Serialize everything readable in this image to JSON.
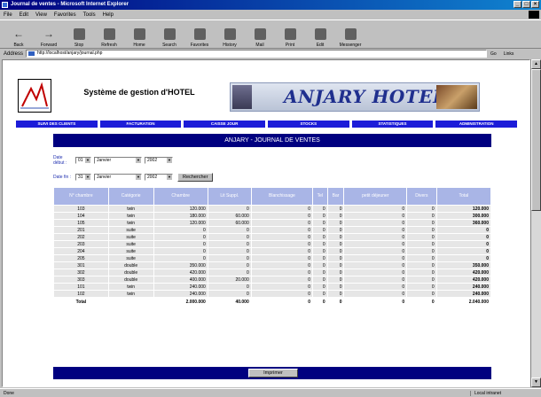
{
  "window": {
    "title": "Journal de ventes - Microsoft Internet Explorer",
    "controls": [
      "_",
      "□",
      "×"
    ]
  },
  "menu": [
    "File",
    "Edit",
    "View",
    "Favorites",
    "Tools",
    "Help"
  ],
  "toolbar": [
    {
      "label": "Back",
      "icon": "back-arrow-icon"
    },
    {
      "label": "Forward",
      "icon": "forward-arrow-icon"
    },
    {
      "label": "Stop",
      "icon": "stop-icon"
    },
    {
      "label": "Refresh",
      "icon": "refresh-icon"
    },
    {
      "label": "Home",
      "icon": "home-icon"
    },
    {
      "label": "Search",
      "icon": "search-icon"
    },
    {
      "label": "Favorites",
      "icon": "favorites-icon"
    },
    {
      "label": "History",
      "icon": "history-icon"
    },
    {
      "label": "Mail",
      "icon": "mail-icon"
    },
    {
      "label": "Print",
      "icon": "print-icon"
    },
    {
      "label": "Edit",
      "icon": "edit-icon"
    },
    {
      "label": "Messenger",
      "icon": "messenger-icon"
    }
  ],
  "address": {
    "label": "Address",
    "url": "http://localhost/anjary/journal.php",
    "go": "Go",
    "links": "Links"
  },
  "site": {
    "title": "Système de gestion d'HOTEL",
    "brand": "ANJARY HOTEL",
    "nav": [
      "SUIVI DES CLIENTS",
      "FACTURATION",
      "CAISSE JOUR",
      "STOCKS",
      "STATISTIQUES",
      "ADMINISTRATION"
    ],
    "page_heading": "ANJARY - JOURNAL DE VENTES"
  },
  "filters": {
    "start_label": "Date début :",
    "end_label": "Date fin :",
    "start": {
      "day": "01",
      "month": "Janvier",
      "year": "2002"
    },
    "end": {
      "day": "31",
      "month": "Janvier",
      "year": "2002"
    },
    "search_label": "Rechercher"
  },
  "table": {
    "headers": [
      "N° chambre",
      "Catégorie",
      "Chambre",
      "Lit Suppl.",
      "Blanchissage",
      "Tel",
      "Bar",
      "petit déjeuner",
      "Divers",
      "Total"
    ],
    "rows": [
      [
        "103",
        "twin",
        "120.000",
        "0",
        "0",
        "0",
        "0",
        "0",
        "0",
        "120.000"
      ],
      [
        "104",
        "twin",
        "180.000",
        "60.000",
        "0",
        "0",
        "0",
        "0",
        "0",
        "300.000"
      ],
      [
        "105",
        "twin",
        "120.000",
        "60.000",
        "0",
        "0",
        "0",
        "0",
        "0",
        "360.000"
      ],
      [
        "201",
        "suite",
        "0",
        "0",
        "0",
        "0",
        "0",
        "0",
        "0",
        "0"
      ],
      [
        "202",
        "suite",
        "0",
        "0",
        "0",
        "0",
        "0",
        "0",
        "0",
        "0"
      ],
      [
        "203",
        "suite",
        "0",
        "0",
        "0",
        "0",
        "0",
        "0",
        "0",
        "0"
      ],
      [
        "204",
        "suite",
        "0",
        "0",
        "0",
        "0",
        "0",
        "0",
        "0",
        "0"
      ],
      [
        "205",
        "suite",
        "0",
        "0",
        "0",
        "0",
        "0",
        "0",
        "0",
        "0"
      ],
      [
        "301",
        "double",
        "350.000",
        "0",
        "0",
        "0",
        "0",
        "0",
        "0",
        "350.000"
      ],
      [
        "302",
        "double",
        "420.000",
        "0",
        "0",
        "0",
        "0",
        "0",
        "0",
        "420.000"
      ],
      [
        "303",
        "double",
        "400.000",
        "20.000",
        "0",
        "0",
        "0",
        "0",
        "0",
        "420.000"
      ],
      [
        "101",
        "twin",
        "240.000",
        "0",
        "0",
        "0",
        "0",
        "0",
        "0",
        "240.000"
      ],
      [
        "102",
        "twin",
        "240.000",
        "0",
        "0",
        "0",
        "0",
        "0",
        "0",
        "240.000"
      ]
    ],
    "total": [
      "Total",
      "",
      "2.000.000",
      "40.000",
      "0",
      "0",
      "0",
      "0",
      "0",
      "2.040.000"
    ]
  },
  "print_label": "Imprimer",
  "status": {
    "left": "Done",
    "right": "Local intranet"
  }
}
